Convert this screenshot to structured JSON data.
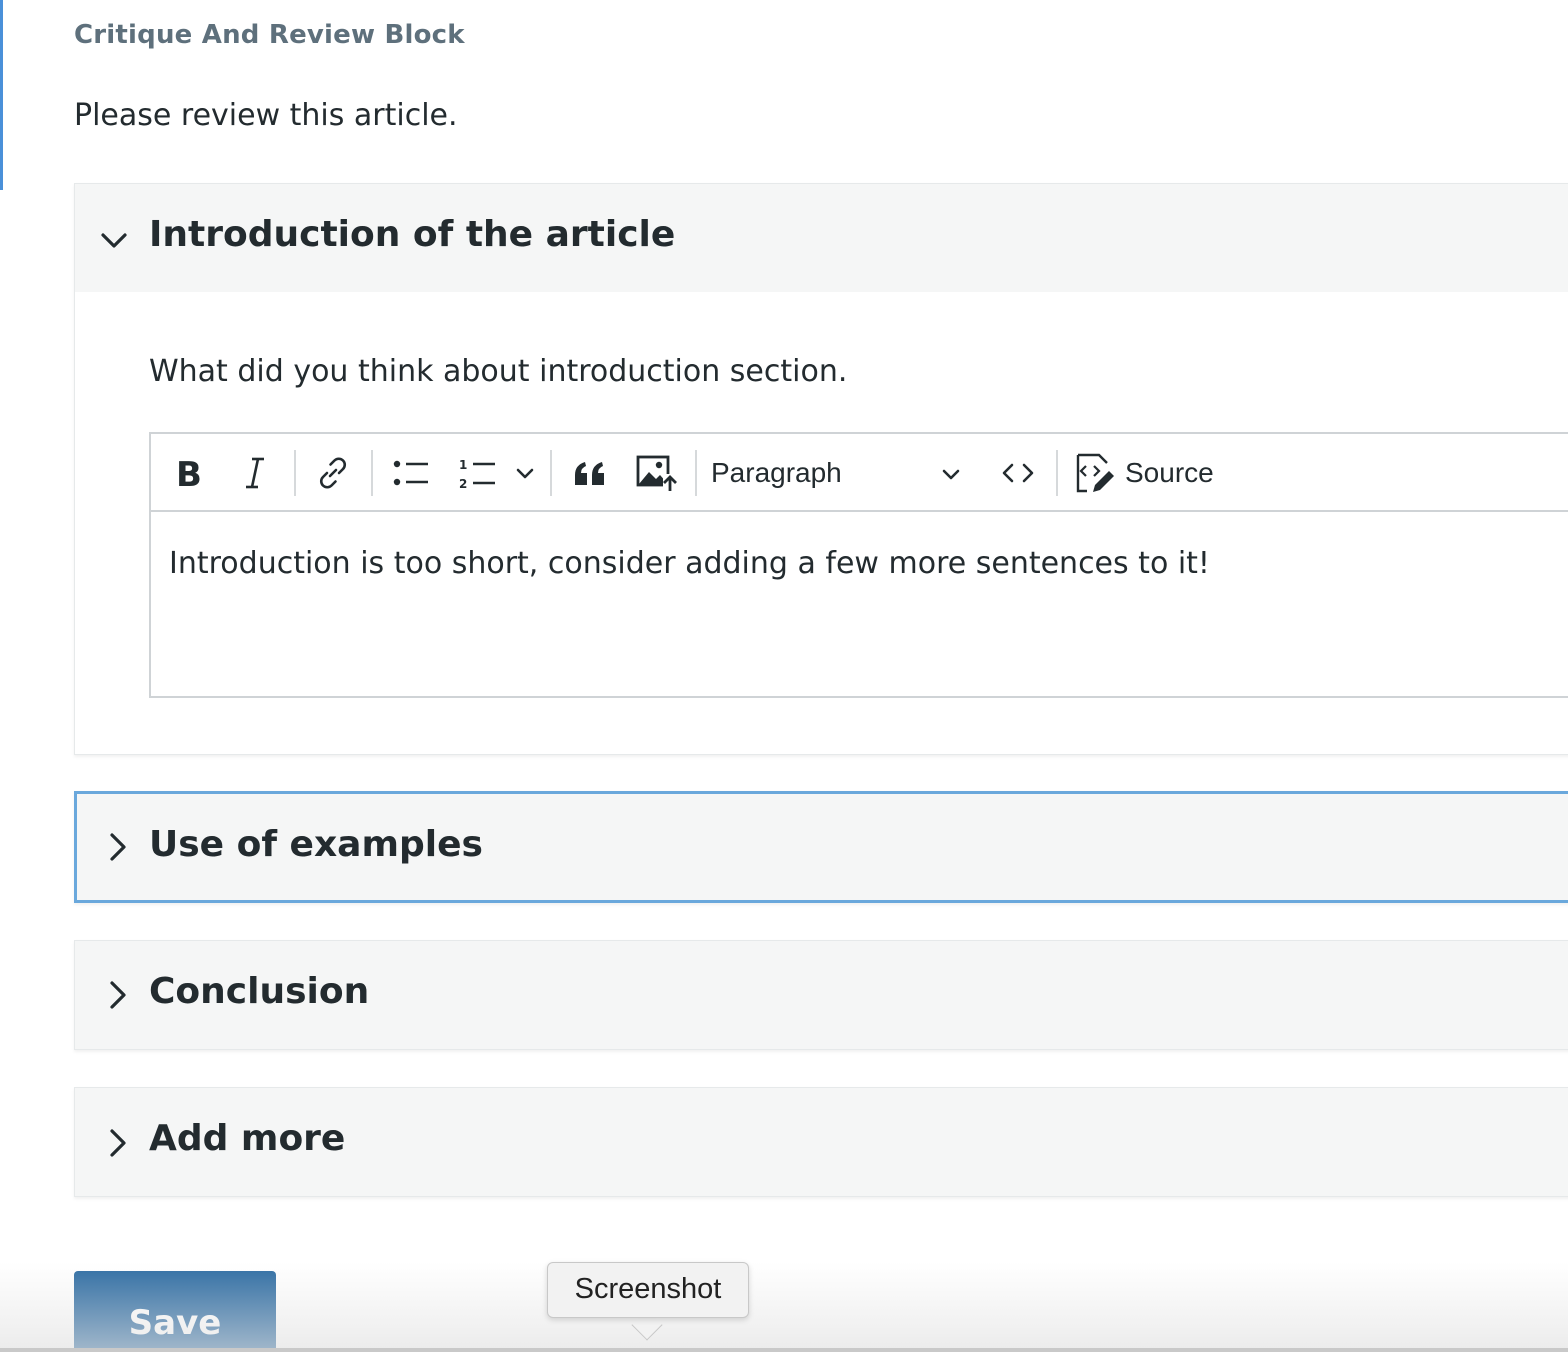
{
  "block": {
    "title": "Critique And Review Block",
    "instructions": "Please review this article."
  },
  "sections": [
    {
      "label": "Introduction of the article",
      "expanded": true,
      "prompt": "What did you think about introduction section.",
      "response": "Introduction is too short, consider adding a few more sentences to it!"
    },
    {
      "label": "Use of examples",
      "expanded": false
    },
    {
      "label": "Conclusion",
      "expanded": false
    },
    {
      "label": "Add more",
      "expanded": false
    }
  ],
  "toolbar": {
    "icons": [
      "bold-icon",
      "italic-icon",
      "link-icon",
      "bulleted-list-icon",
      "numbered-list-icon",
      "chevron-down-icon",
      "block-quote-icon",
      "insert-image-icon",
      "code-icon",
      "source-icon"
    ],
    "heading_select": "Paragraph",
    "source_label": "Source"
  },
  "actions": {
    "save_label": "Save"
  },
  "tooltip": {
    "label": "Screenshot"
  },
  "colors": {
    "accent": "#4a90d9",
    "focus_border": "#6aa8dc",
    "save_button": "#2f6da3",
    "title_gray": "#5e707c"
  }
}
